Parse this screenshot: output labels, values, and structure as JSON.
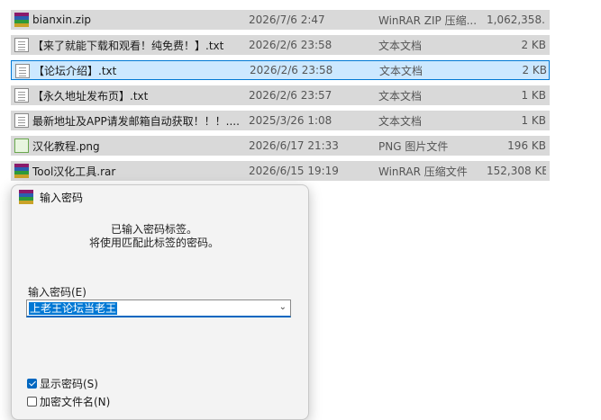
{
  "files": [
    {
      "name": "bianxin.zip",
      "date": "2026/7/6 2:47",
      "type": "WinRAR ZIP 压缩...",
      "size": "1,062,358...",
      "icon": "rar-icon",
      "selected": false
    },
    {
      "name": "【来了就能下载和观看！纯免费！】.txt",
      "date": "2026/2/6 23:58",
      "type": "文本文档",
      "size": "2 KB",
      "icon": "txt-icon",
      "selected": false
    },
    {
      "name": "【论坛介绍】.txt",
      "date": "2026/2/6 23:58",
      "type": "文本文档",
      "size": "2 KB",
      "icon": "txt-icon",
      "selected": true
    },
    {
      "name": "【永久地址发布页】.txt",
      "date": "2026/2/6 23:57",
      "type": "文本文档",
      "size": "1 KB",
      "icon": "txt-icon",
      "selected": false
    },
    {
      "name": "最新地址及APP请发邮箱自动获取！！！....",
      "date": "2025/3/26 1:08",
      "type": "文本文档",
      "size": "1 KB",
      "icon": "txt-icon",
      "selected": false
    },
    {
      "name": "汉化教程.png",
      "date": "2026/6/17 21:33",
      "type": "PNG 图片文件",
      "size": "196 KB",
      "icon": "png-icon",
      "selected": false
    },
    {
      "name": "Tool汉化工具.rar",
      "date": "2026/6/15 19:19",
      "type": "WinRAR 压缩文件",
      "size": "152,308 KB",
      "icon": "rar-icon",
      "selected": false
    }
  ],
  "dialog": {
    "title": "输入密码",
    "message_line1": "已输入密码标签。",
    "message_line2": "将使用匹配此标签的密码。",
    "password_label": "输入密码(E)",
    "password_value": "上老王论坛当老王",
    "show_password_label": "显示密码(S)",
    "show_password_checked": true,
    "encrypt_filenames_label": "加密文件名(N)",
    "encrypt_filenames_checked": false
  },
  "colors": {
    "row_bg": "#d9d9d9",
    "selected_bg": "#cce8ff",
    "selected_border": "#0078d4",
    "accent": "#0067c0"
  }
}
